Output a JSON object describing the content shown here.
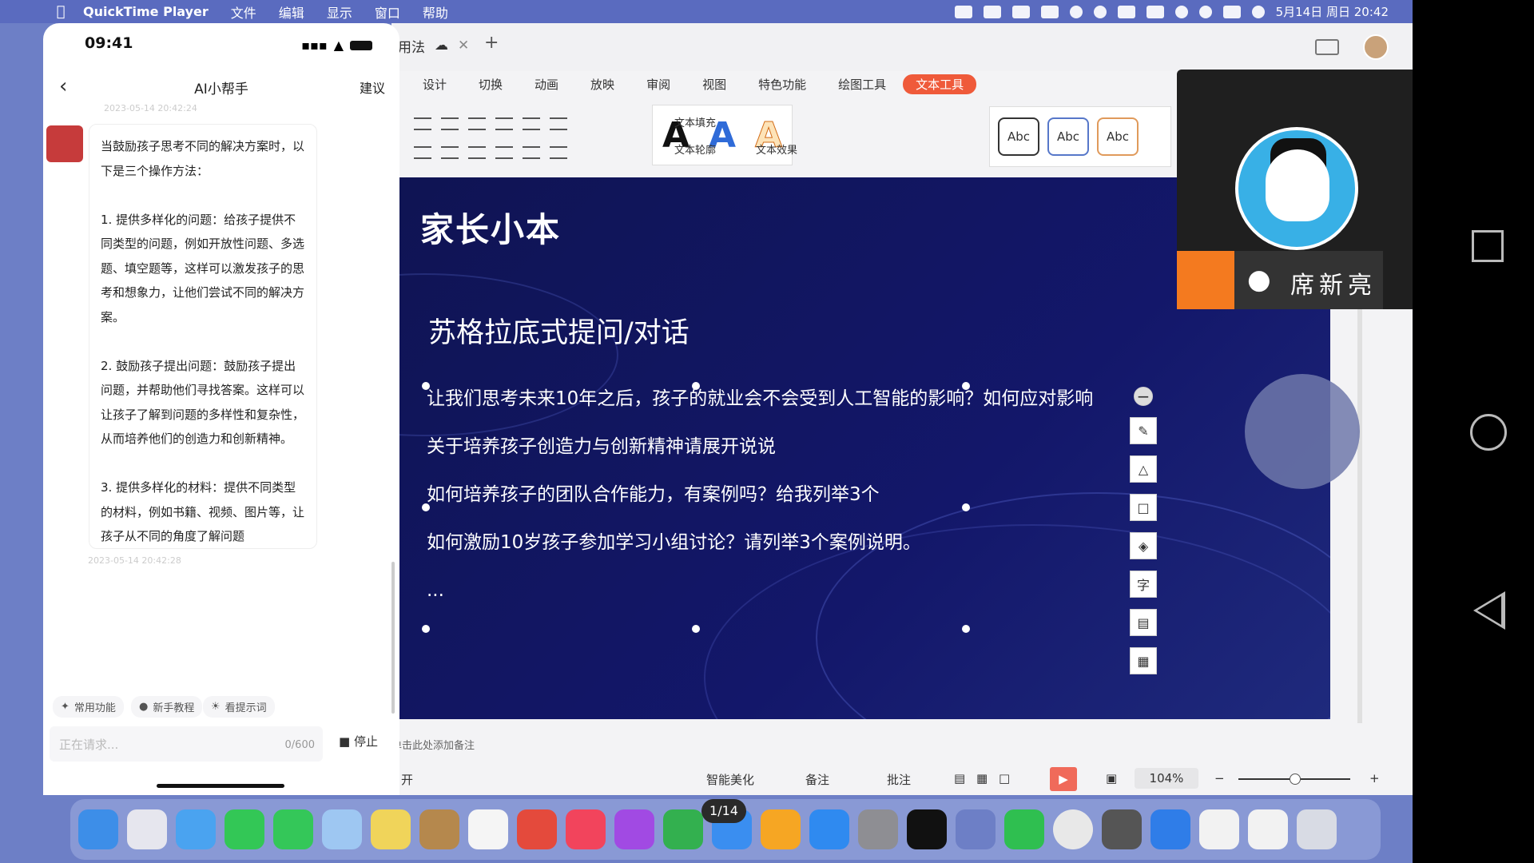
{
  "menubar": {
    "app": "QuickTime Player",
    "items": [
      "文件",
      "编辑",
      "显示",
      "窗口",
      "帮助"
    ],
    "datetime": "5月14日 周日 20:42"
  },
  "wps": {
    "doc_tab": "用法",
    "ribbon_tabs": [
      "设计",
      "切换",
      "动画",
      "放映",
      "审阅",
      "视图",
      "特色功能",
      "绘图工具",
      "文本工具"
    ],
    "text_fill": "文本填充",
    "text_outline": "文本轮廓",
    "text_effect": "文本效果",
    "abc": "Abc",
    "slide": {
      "logo": "家长小本",
      "title": "苏格拉底式提问/对话",
      "lines": [
        "让我们思考未来10年之后，孩子的就业会不会受到人工智能的影响？如何应对影响",
        "关于培养孩子创造力与创新精神请展开说说",
        "如何培养孩子的团队合作能力，有案例吗？给我列举3个",
        "如何激励10岁孩子参加学习小组讨论？请列举3个案例说明。",
        "..."
      ]
    },
    "notes_label": "单击此处添加备注",
    "status": {
      "left": "开",
      "smart": "智能美化",
      "notes": "备注",
      "comments": "批注",
      "zoom": "104%"
    }
  },
  "phone": {
    "time": "09:41",
    "nav_title": "AI小帮手",
    "nav_right": "建议",
    "ts1": "2023-05-14 20:42:24",
    "ts2": "2023-05-14 20:42:28",
    "message": "当鼓励孩子思考不同的解决方案时，以下是三个操作方法：\n\n1. 提供多样化的问题：给孩子提供不同类型的问题，例如开放性问题、多选题、填空题等，这样可以激发孩子的思考和想象力，让他们尝试不同的解决方案。\n\n2. 鼓励孩子提出问题：鼓励孩子提出问题，并帮助他们寻找答案。这样可以让孩子了解到问题的多样性和复杂性，从而培养他们的创造力和创新精神。\n\n3. 提供多样化的材料：提供不同类型的材料，例如书籍、视频、图片等，让孩子从不同的角度了解问题",
    "quick": [
      "常用功能",
      "新手教程",
      "看提示词"
    ],
    "input_placeholder": "正在请求...",
    "input_count": "0/600",
    "stop": "停止"
  },
  "video": {
    "name": "席新亮"
  },
  "dock": {
    "badge": "1/14"
  }
}
